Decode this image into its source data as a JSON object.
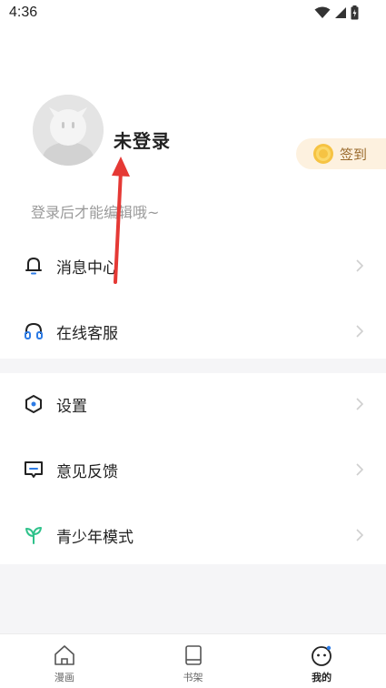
{
  "status_bar": {
    "time": "4:36"
  },
  "profile": {
    "username": "未登录",
    "login_hint": "登录后才能编辑哦~",
    "checkin_label": "签到"
  },
  "menu_group_1": [
    {
      "label": "消息中心",
      "icon": "bell-icon"
    },
    {
      "label": "在线客服",
      "icon": "headset-icon"
    }
  ],
  "menu_group_2": [
    {
      "label": "设置",
      "icon": "settings-icon"
    },
    {
      "label": "意见反馈",
      "icon": "feedback-icon"
    },
    {
      "label": "青少年模式",
      "icon": "sprout-icon"
    }
  ],
  "tab_bar": [
    {
      "label": "漫画",
      "icon": "home-icon",
      "active": false
    },
    {
      "label": "书架",
      "icon": "book-icon",
      "active": false
    },
    {
      "label": "我的",
      "icon": "smiley-icon",
      "active": true
    }
  ],
  "colors": {
    "accent_blue": "#2d7be5",
    "sprout_green": "#2fc28b",
    "checkin_bg": "#fdf1df",
    "checkin_text": "#9a6a2c",
    "annotation_red": "#e53935"
  }
}
